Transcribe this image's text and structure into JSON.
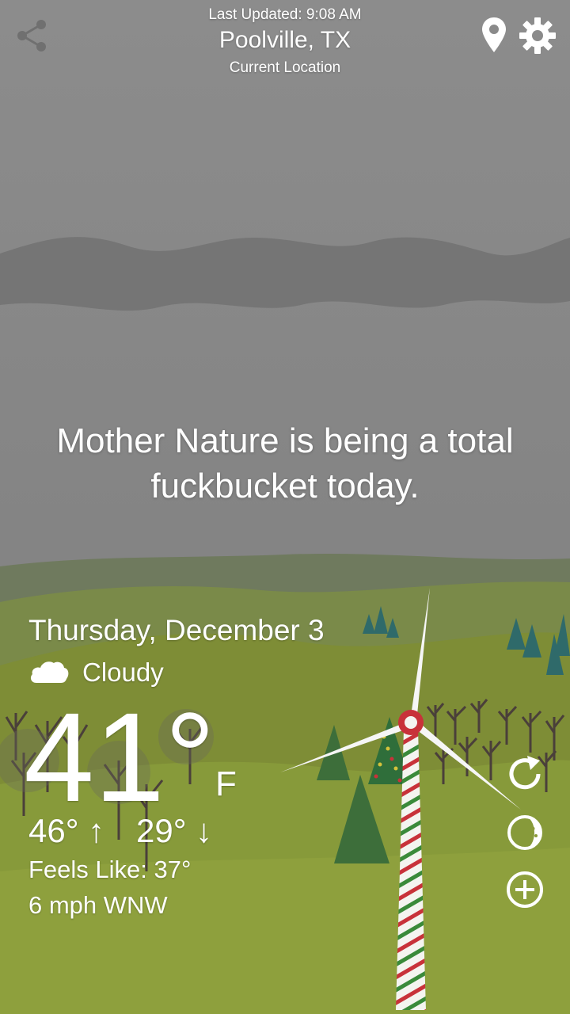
{
  "header": {
    "last_updated": "Last Updated: 9:08 AM",
    "city": "Poolville, TX",
    "location_note": "Current Location"
  },
  "message": "Mother Nature is being a total fuckbucket today.",
  "weather": {
    "date": "Thursday, December 3",
    "condition": "Cloudy",
    "condition_icon": "cloud-icon",
    "temperature": "41°",
    "unit": "F",
    "high": "46° ↑",
    "low": "29° ↓",
    "feels_like": "Feels Like: 37°",
    "wind": "6 mph WNW"
  },
  "icons": {
    "share": "share-icon",
    "location": "location-pin-icon",
    "settings": "gear-icon",
    "refresh": "refresh-icon",
    "moon": "moon-phase-icon",
    "add": "add-location-icon"
  },
  "colors": {
    "sky": "#8a8a8a",
    "hills_far": "#6f7a5e",
    "hills_mid": "#7c8a3e",
    "ground": "#8a9a3a",
    "tree_dark": "#3d6e3a",
    "stripe_red": "#c8323a",
    "stripe_green": "#3a8a3a"
  }
}
